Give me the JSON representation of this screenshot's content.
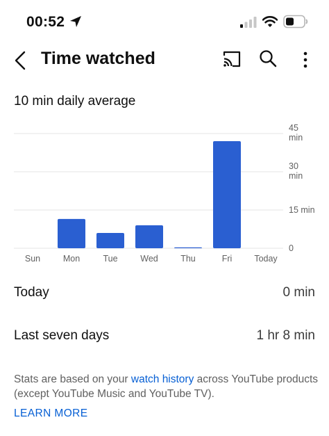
{
  "status_bar": {
    "time": "00:52"
  },
  "header": {
    "title": "Time watched"
  },
  "summary": {
    "daily_average": "10 min daily average"
  },
  "chart_data": {
    "type": "bar",
    "categories": [
      "Sun",
      "Mon",
      "Tue",
      "Wed",
      "Thu",
      "Fri",
      "Today"
    ],
    "values": [
      0,
      11.5,
      6,
      9,
      0.3,
      42,
      0
    ],
    "y_ticks": [
      {
        "value": 45,
        "label": "45\nmin"
      },
      {
        "value": 30,
        "label": "30\nmin"
      },
      {
        "value": 15,
        "label": "15 min"
      },
      {
        "value": 0,
        "label": "0"
      }
    ],
    "ylim": [
      0,
      45
    ],
    "unit": "min",
    "grid": true,
    "bar_color": "#2a5fd1"
  },
  "stats": [
    {
      "label": "Today",
      "value": "0 min"
    },
    {
      "label": "Last seven days",
      "value": "1 hr 8 min"
    }
  ],
  "footer": {
    "note_before": "Stats are based on your ",
    "note_link": "watch history",
    "note_after": " across YouTube products (except YouTube Music and YouTube TV).",
    "learn_more": "LEARN MORE"
  },
  "colors": {
    "link": "#065fd4",
    "grid": "#e5e5e5",
    "bar": "#2a5fd1"
  },
  "icons": [
    "location-arrow-icon",
    "signal-icon",
    "wifi-icon",
    "battery-icon",
    "back-icon",
    "cast-icon",
    "search-icon",
    "more-vert-icon"
  ]
}
